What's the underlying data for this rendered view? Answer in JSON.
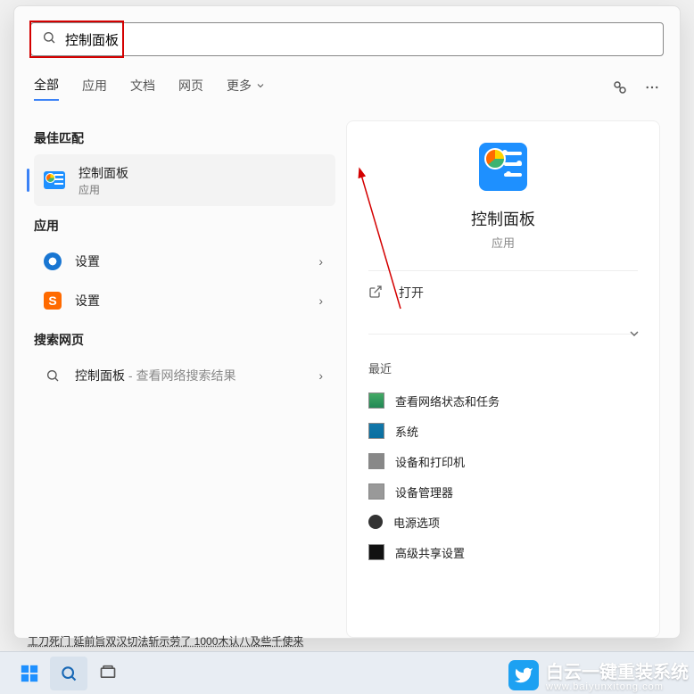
{
  "search": {
    "value": "控制面板"
  },
  "tabs": {
    "all": "全部",
    "apps": "应用",
    "docs": "文档",
    "web": "网页",
    "more": "更多"
  },
  "left": {
    "best_match_hdr": "最佳匹配",
    "best": {
      "title": "控制面板",
      "subtitle": "应用"
    },
    "apps_hdr": "应用",
    "app1": "设置",
    "app2": "设置",
    "web_hdr": "搜索网页",
    "web_item_main": "控制面板",
    "web_item_sub": " - 查看网络搜索结果"
  },
  "preview": {
    "title": "控制面板",
    "subtitle": "应用",
    "open": "打开",
    "recent_hdr": "最近",
    "recent": {
      "r1": "查看网络状态和任务",
      "r2": "系统",
      "r3": "设备和打印机",
      "r4": "设备管理器",
      "r5": "电源选项",
      "r6": "高级共享设置"
    }
  },
  "truncated_line": "工刀死门 延前旨双汉切法斩示劳了 1000木认八及些千使来",
  "watermark": {
    "main": "白云一键重装系统",
    "sub": "www.baiyunxitong.com"
  }
}
